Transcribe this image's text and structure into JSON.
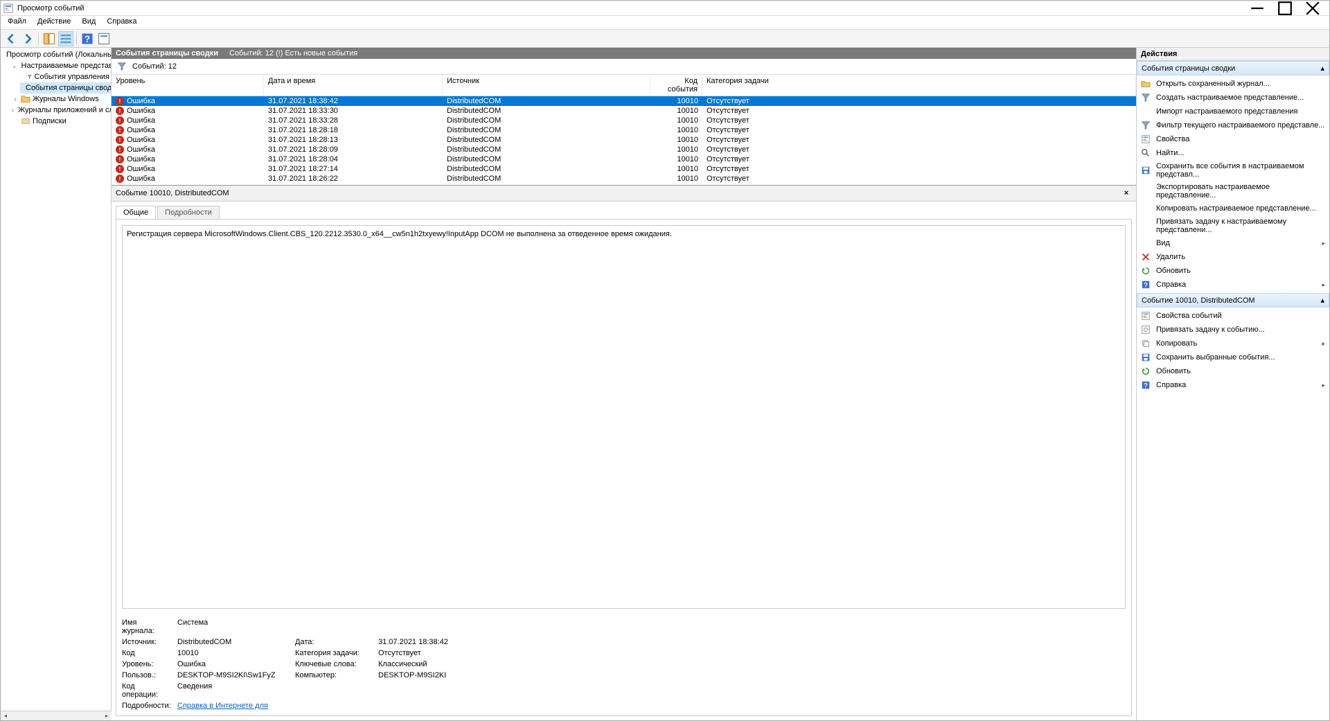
{
  "title": "Просмотр событий",
  "menubar": [
    "Файл",
    "Действие",
    "Вид",
    "Справка"
  ],
  "tree": {
    "root": "Просмотр событий (Локальны",
    "customViews": "Настраиваемые представле",
    "adminEvents": "События управления",
    "summaryPage": "События страницы свод",
    "winLogs": "Журналы Windows",
    "appLogs": "Журналы приложений и сл",
    "subscriptions": "Подписки"
  },
  "centerHeader": {
    "title": "События страницы сводки",
    "subtitle": "Событий: 12 (!) Есть новые события"
  },
  "filterRow": {
    "count": "Событий: 12"
  },
  "columns": {
    "level": "Уровень",
    "date": "Дата и время",
    "source": "Источник",
    "code": "Код события",
    "cat": "Категория задачи"
  },
  "events": [
    {
      "level": "Ошибка",
      "date": "31.07.2021 18:38:42",
      "source": "DistributedCOM",
      "code": "10010",
      "cat": "Отсутствует",
      "selected": true
    },
    {
      "level": "Ошибка",
      "date": "31.07.2021 18:33:30",
      "source": "DistributedCOM",
      "code": "10010",
      "cat": "Отсутствует"
    },
    {
      "level": "Ошибка",
      "date": "31.07.2021 18:33:28",
      "source": "DistributedCOM",
      "code": "10010",
      "cat": "Отсутствует"
    },
    {
      "level": "Ошибка",
      "date": "31.07.2021 18:28:18",
      "source": "DistributedCOM",
      "code": "10010",
      "cat": "Отсутствует"
    },
    {
      "level": "Ошибка",
      "date": "31.07.2021 18:28:13",
      "source": "DistributedCOM",
      "code": "10010",
      "cat": "Отсутствует"
    },
    {
      "level": "Ошибка",
      "date": "31.07.2021 18:28:09",
      "source": "DistributedCOM",
      "code": "10010",
      "cat": "Отсутствует"
    },
    {
      "level": "Ошибка",
      "date": "31.07.2021 18:28:04",
      "source": "DistributedCOM",
      "code": "10010",
      "cat": "Отсутствует"
    },
    {
      "level": "Ошибка",
      "date": "31.07.2021 18:27:14",
      "source": "DistributedCOM",
      "code": "10010",
      "cat": "Отсутствует"
    },
    {
      "level": "Ошибка",
      "date": "31.07.2021 18:26:22",
      "source": "DistributedCOM",
      "code": "10010",
      "cat": "Отсутствует"
    }
  ],
  "detail": {
    "header": "Событие 10010, DistributedCOM",
    "tabGeneral": "Общие",
    "tabDetails": "Подробности",
    "message": "Регистрация сервера MicrosoftWindows.Client.CBS_120.2212.3530.0_x64__cw5n1h2txyewy!InputApp DCOM не выполнена за отведенное время ожидания.",
    "fields": {
      "logNameK": "Имя журнала:",
      "logNameV": "Система",
      "sourceK": "Источник:",
      "sourceV": "DistributedCOM",
      "dateK": "Дата:",
      "dateV": "31.07.2021 18:38:42",
      "codeK": "Код",
      "codeV": "10010",
      "catK": "Категория задачи:",
      "catV": "Отсутствует",
      "levelK": "Уровень:",
      "levelV": "Ошибка",
      "keywordsK": "Ключевые слова:",
      "keywordsV": "Классический",
      "userK": "Пользов.:",
      "userV": "DESKTOP-M9SI2KI\\Sw1FyZ",
      "computerK": "Компьютер:",
      "computerV": "DESKTOP-M9SI2KI",
      "opcodeK": "Код операции:",
      "opcodeV": "Сведения",
      "detailsK": "Подробности:",
      "detailsV": "Справка в Интернете для "
    }
  },
  "actions": {
    "title": "Действия",
    "section1": "События страницы сводки",
    "items1": [
      {
        "label": "Открыть сохраненный журнал...",
        "icon": "folder-open-icon"
      },
      {
        "label": "Создать настраиваемое представление...",
        "icon": "filter-icon"
      },
      {
        "label": "Импорт настраиваемого представления",
        "icon": "blank-icon"
      },
      {
        "label": "Фильтр текущего настраиваемого представле...",
        "icon": "filter-icon"
      },
      {
        "label": "Свойства",
        "icon": "properties-icon"
      },
      {
        "label": "Найти...",
        "icon": "find-icon"
      },
      {
        "label": "Сохранить все события в настраиваемом представл...",
        "icon": "save-icon"
      },
      {
        "label": "Экспортировать настраиваемое представление...",
        "icon": "blank-icon"
      },
      {
        "label": "Копировать настраиваемое представление...",
        "icon": "blank-icon"
      },
      {
        "label": "Привязать задачу к настраиваемому представлени...",
        "icon": "blank-icon"
      },
      {
        "label": "Вид",
        "icon": "blank-icon",
        "submenu": true
      },
      {
        "label": "Удалить",
        "icon": "delete-icon"
      },
      {
        "label": "Обновить",
        "icon": "refresh-icon"
      },
      {
        "label": "Справка",
        "icon": "help-icon",
        "submenu": true
      }
    ],
    "section2": "Событие 10010, DistributedCOM",
    "items2": [
      {
        "label": "Свойства событий",
        "icon": "properties-icon"
      },
      {
        "label": "Привязать задачу к событию...",
        "icon": "task-icon"
      },
      {
        "label": "Копировать",
        "icon": "copy-icon",
        "submenu": true
      },
      {
        "label": "Сохранить выбранные события...",
        "icon": "save-icon"
      },
      {
        "label": "Обновить",
        "icon": "refresh-icon"
      },
      {
        "label": "Справка",
        "icon": "help-icon",
        "submenu": true
      }
    ]
  }
}
